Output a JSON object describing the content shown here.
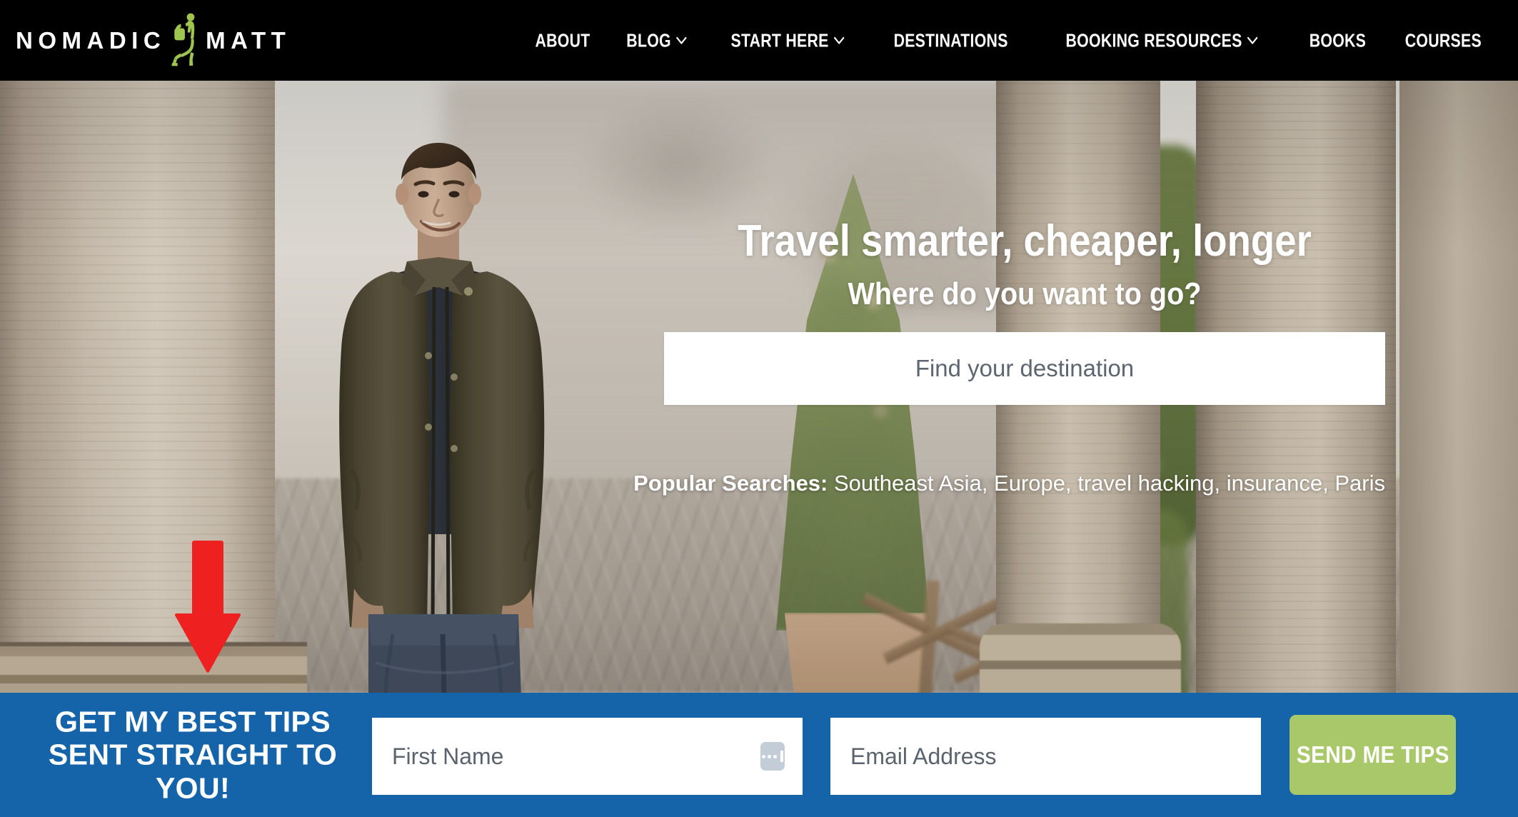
{
  "header": {
    "logo": {
      "text_left": "NOMADIC",
      "text_right": "MATT",
      "mark": "backpacker-silhouette-icon",
      "mark_color": "#9fc44f"
    },
    "nav": [
      {
        "label": "ABOUT",
        "has_dropdown": false
      },
      {
        "label": "BLOG",
        "has_dropdown": true
      },
      {
        "label": "START HERE",
        "has_dropdown": true
      },
      {
        "label": "DESTINATIONS",
        "has_dropdown": false
      },
      {
        "label": "BOOKING RESOURCES",
        "has_dropdown": true
      },
      {
        "label": "BOOKS",
        "has_dropdown": false
      },
      {
        "label": "COURSES",
        "has_dropdown": false
      }
    ],
    "background": "#000000"
  },
  "hero": {
    "headline": "Travel smarter, cheaper, longer",
    "subheadline": "Where do you want to go?",
    "search": {
      "placeholder": "Find your destination",
      "value": ""
    },
    "popular_label": "Popular Searches:",
    "popular_items": "Southeast Asia, Europe, travel hacking, insurance, Paris",
    "annotation": {
      "type": "down-arrow",
      "color": "#ee2020"
    }
  },
  "newsletter": {
    "heading": "GET MY BEST TIPS SENT STRAIGHT TO YOU!",
    "first_name": {
      "placeholder": "First Name",
      "value": ""
    },
    "email": {
      "placeholder": "Email Address",
      "value": ""
    },
    "autofill_icon": "password-manager-icon",
    "button_label": "SEND ME TIPS",
    "background": "#1563a9",
    "button_color": "#a9c86a"
  }
}
